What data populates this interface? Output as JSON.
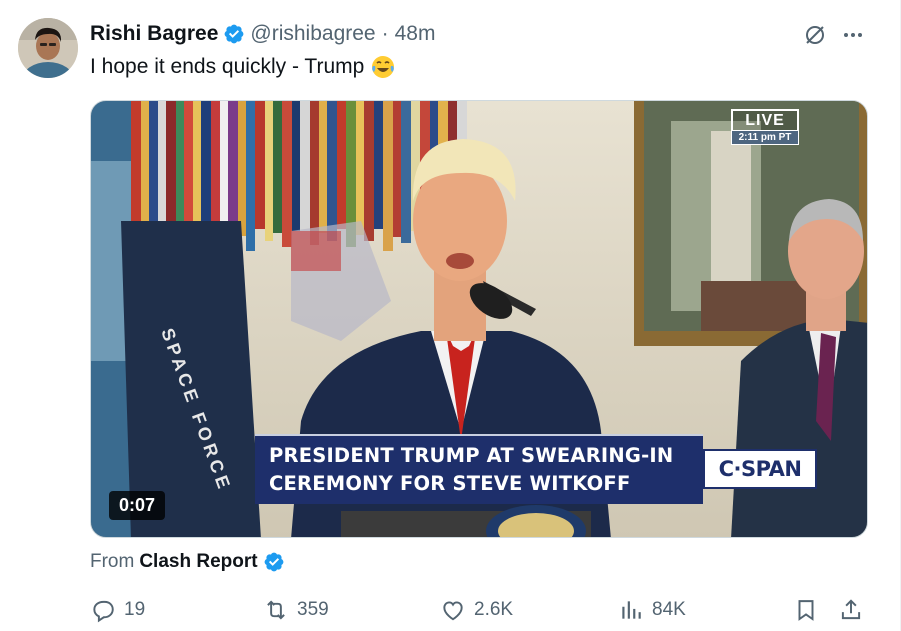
{
  "tweet": {
    "author": {
      "display_name": "Rishi Bagree",
      "handle": "@rishibagree",
      "verified": true,
      "verified_color": "#1d9bf0"
    },
    "separator": "·",
    "timestamp": "48m",
    "text": "I hope it ends quickly - Trump",
    "emoji": "face-with-tears-of-joy"
  },
  "media": {
    "live_badge": {
      "label": "LIVE",
      "time": "2:11 pm PT"
    },
    "lower_third": {
      "line1": "PRESIDENT TRUMP AT SWEARING-IN",
      "line2": "CEREMONY FOR STEVE WITKOFF"
    },
    "network_logo": "C·SPAN",
    "flag_text": "SPACE FORCE",
    "duration": "0:07"
  },
  "attribution": {
    "prefix": "From",
    "source": "Clash Report",
    "verified": true
  },
  "actions": {
    "replies": "19",
    "reposts": "359",
    "likes": "2.6K",
    "views": "84K"
  },
  "icons": {
    "grok": "grok-icon",
    "more": "more-icon",
    "reply": "reply-icon",
    "repost": "repost-icon",
    "like": "heart-icon",
    "views": "views-icon",
    "bookmark": "bookmark-icon",
    "share": "share-icon"
  },
  "colors": {
    "text_primary": "#0f1419",
    "text_secondary": "#536471",
    "accent": "#1d9bf0",
    "lower_third_bg": "#1e2f6b"
  }
}
